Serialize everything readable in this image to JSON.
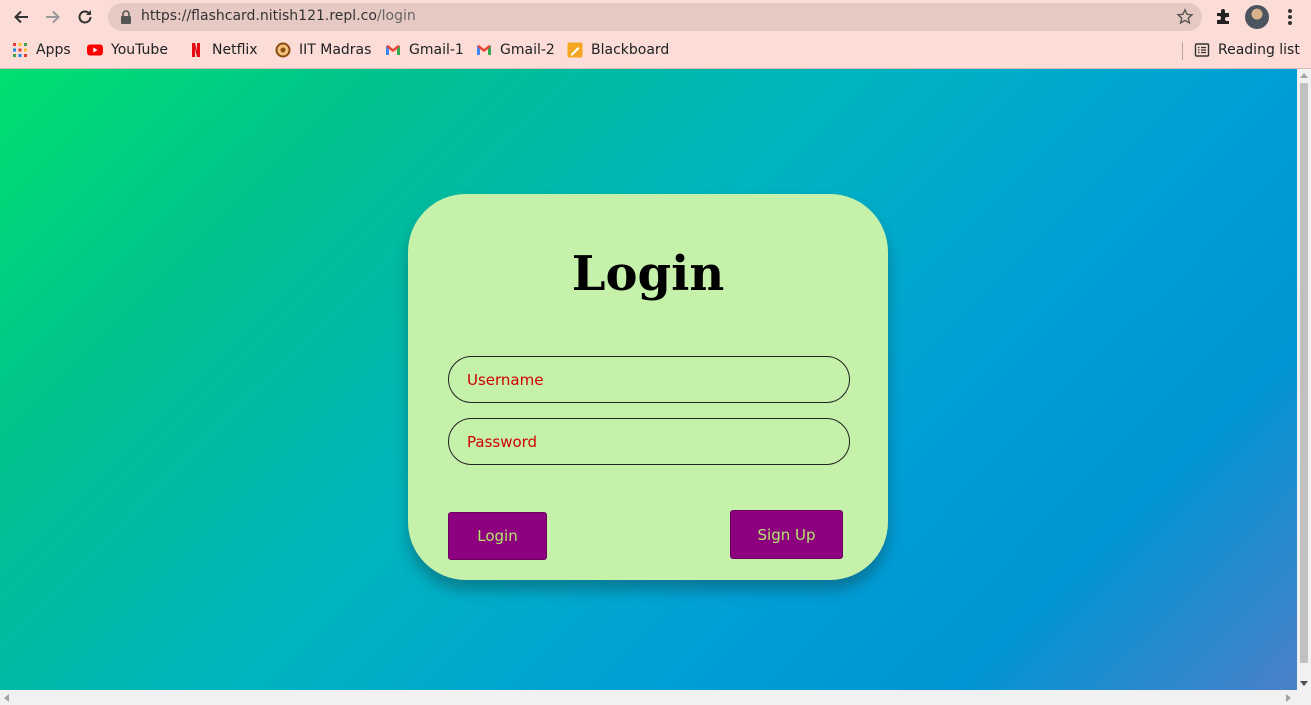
{
  "browser": {
    "url_host": "https://flashcard.nitish121.repl.co",
    "url_path": "/login",
    "bookmarks": [
      {
        "label": "Apps",
        "icon": "apps-grid-icon"
      },
      {
        "label": "YouTube",
        "icon": "youtube-icon"
      },
      {
        "label": "Netflix",
        "icon": "netflix-icon"
      },
      {
        "label": "IIT Madras",
        "icon": "iit-madras-icon"
      },
      {
        "label": "Gmail-1",
        "icon": "gmail-icon"
      },
      {
        "label": "Gmail-2",
        "icon": "gmail-icon"
      },
      {
        "label": "Blackboard",
        "icon": "blackboard-icon"
      }
    ],
    "reading_list_label": "Reading list"
  },
  "login_form": {
    "title": "Login",
    "username_placeholder": "Username",
    "password_placeholder": "Password",
    "login_button": "Login",
    "signup_button": "Sign Up"
  },
  "colors": {
    "card_bg": "#c6f1aa",
    "button_bg": "#8d0080",
    "button_text": "#b4e86a",
    "placeholder_text": "#d00000"
  }
}
